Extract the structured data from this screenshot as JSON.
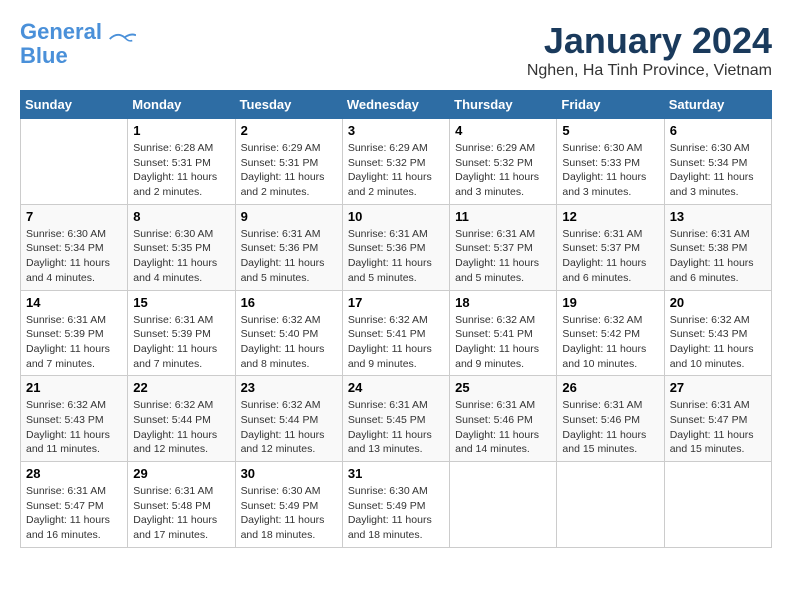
{
  "header": {
    "logo_line1": "General",
    "logo_line2": "Blue",
    "month_title": "January 2024",
    "location": "Nghen, Ha Tinh Province, Vietnam"
  },
  "days_of_week": [
    "Sunday",
    "Monday",
    "Tuesday",
    "Wednesday",
    "Thursday",
    "Friday",
    "Saturday"
  ],
  "weeks": [
    [
      {
        "day": "",
        "info": ""
      },
      {
        "day": "1",
        "info": "Sunrise: 6:28 AM\nSunset: 5:31 PM\nDaylight: 11 hours\nand 2 minutes."
      },
      {
        "day": "2",
        "info": "Sunrise: 6:29 AM\nSunset: 5:31 PM\nDaylight: 11 hours\nand 2 minutes."
      },
      {
        "day": "3",
        "info": "Sunrise: 6:29 AM\nSunset: 5:32 PM\nDaylight: 11 hours\nand 2 minutes."
      },
      {
        "day": "4",
        "info": "Sunrise: 6:29 AM\nSunset: 5:32 PM\nDaylight: 11 hours\nand 3 minutes."
      },
      {
        "day": "5",
        "info": "Sunrise: 6:30 AM\nSunset: 5:33 PM\nDaylight: 11 hours\nand 3 minutes."
      },
      {
        "day": "6",
        "info": "Sunrise: 6:30 AM\nSunset: 5:34 PM\nDaylight: 11 hours\nand 3 minutes."
      }
    ],
    [
      {
        "day": "7",
        "info": "Sunrise: 6:30 AM\nSunset: 5:34 PM\nDaylight: 11 hours\nand 4 minutes."
      },
      {
        "day": "8",
        "info": "Sunrise: 6:30 AM\nSunset: 5:35 PM\nDaylight: 11 hours\nand 4 minutes."
      },
      {
        "day": "9",
        "info": "Sunrise: 6:31 AM\nSunset: 5:36 PM\nDaylight: 11 hours\nand 5 minutes."
      },
      {
        "day": "10",
        "info": "Sunrise: 6:31 AM\nSunset: 5:36 PM\nDaylight: 11 hours\nand 5 minutes."
      },
      {
        "day": "11",
        "info": "Sunrise: 6:31 AM\nSunset: 5:37 PM\nDaylight: 11 hours\nand 5 minutes."
      },
      {
        "day": "12",
        "info": "Sunrise: 6:31 AM\nSunset: 5:37 PM\nDaylight: 11 hours\nand 6 minutes."
      },
      {
        "day": "13",
        "info": "Sunrise: 6:31 AM\nSunset: 5:38 PM\nDaylight: 11 hours\nand 6 minutes."
      }
    ],
    [
      {
        "day": "14",
        "info": "Sunrise: 6:31 AM\nSunset: 5:39 PM\nDaylight: 11 hours\nand 7 minutes."
      },
      {
        "day": "15",
        "info": "Sunrise: 6:31 AM\nSunset: 5:39 PM\nDaylight: 11 hours\nand 7 minutes."
      },
      {
        "day": "16",
        "info": "Sunrise: 6:32 AM\nSunset: 5:40 PM\nDaylight: 11 hours\nand 8 minutes."
      },
      {
        "day": "17",
        "info": "Sunrise: 6:32 AM\nSunset: 5:41 PM\nDaylight: 11 hours\nand 9 minutes."
      },
      {
        "day": "18",
        "info": "Sunrise: 6:32 AM\nSunset: 5:41 PM\nDaylight: 11 hours\nand 9 minutes."
      },
      {
        "day": "19",
        "info": "Sunrise: 6:32 AM\nSunset: 5:42 PM\nDaylight: 11 hours\nand 10 minutes."
      },
      {
        "day": "20",
        "info": "Sunrise: 6:32 AM\nSunset: 5:43 PM\nDaylight: 11 hours\nand 10 minutes."
      }
    ],
    [
      {
        "day": "21",
        "info": "Sunrise: 6:32 AM\nSunset: 5:43 PM\nDaylight: 11 hours\nand 11 minutes."
      },
      {
        "day": "22",
        "info": "Sunrise: 6:32 AM\nSunset: 5:44 PM\nDaylight: 11 hours\nand 12 minutes."
      },
      {
        "day": "23",
        "info": "Sunrise: 6:32 AM\nSunset: 5:44 PM\nDaylight: 11 hours\nand 12 minutes."
      },
      {
        "day": "24",
        "info": "Sunrise: 6:31 AM\nSunset: 5:45 PM\nDaylight: 11 hours\nand 13 minutes."
      },
      {
        "day": "25",
        "info": "Sunrise: 6:31 AM\nSunset: 5:46 PM\nDaylight: 11 hours\nand 14 minutes."
      },
      {
        "day": "26",
        "info": "Sunrise: 6:31 AM\nSunset: 5:46 PM\nDaylight: 11 hours\nand 15 minutes."
      },
      {
        "day": "27",
        "info": "Sunrise: 6:31 AM\nSunset: 5:47 PM\nDaylight: 11 hours\nand 15 minutes."
      }
    ],
    [
      {
        "day": "28",
        "info": "Sunrise: 6:31 AM\nSunset: 5:47 PM\nDaylight: 11 hours\nand 16 minutes."
      },
      {
        "day": "29",
        "info": "Sunrise: 6:31 AM\nSunset: 5:48 PM\nDaylight: 11 hours\nand 17 minutes."
      },
      {
        "day": "30",
        "info": "Sunrise: 6:30 AM\nSunset: 5:49 PM\nDaylight: 11 hours\nand 18 minutes."
      },
      {
        "day": "31",
        "info": "Sunrise: 6:30 AM\nSunset: 5:49 PM\nDaylight: 11 hours\nand 18 minutes."
      },
      {
        "day": "",
        "info": ""
      },
      {
        "day": "",
        "info": ""
      },
      {
        "day": "",
        "info": ""
      }
    ]
  ]
}
